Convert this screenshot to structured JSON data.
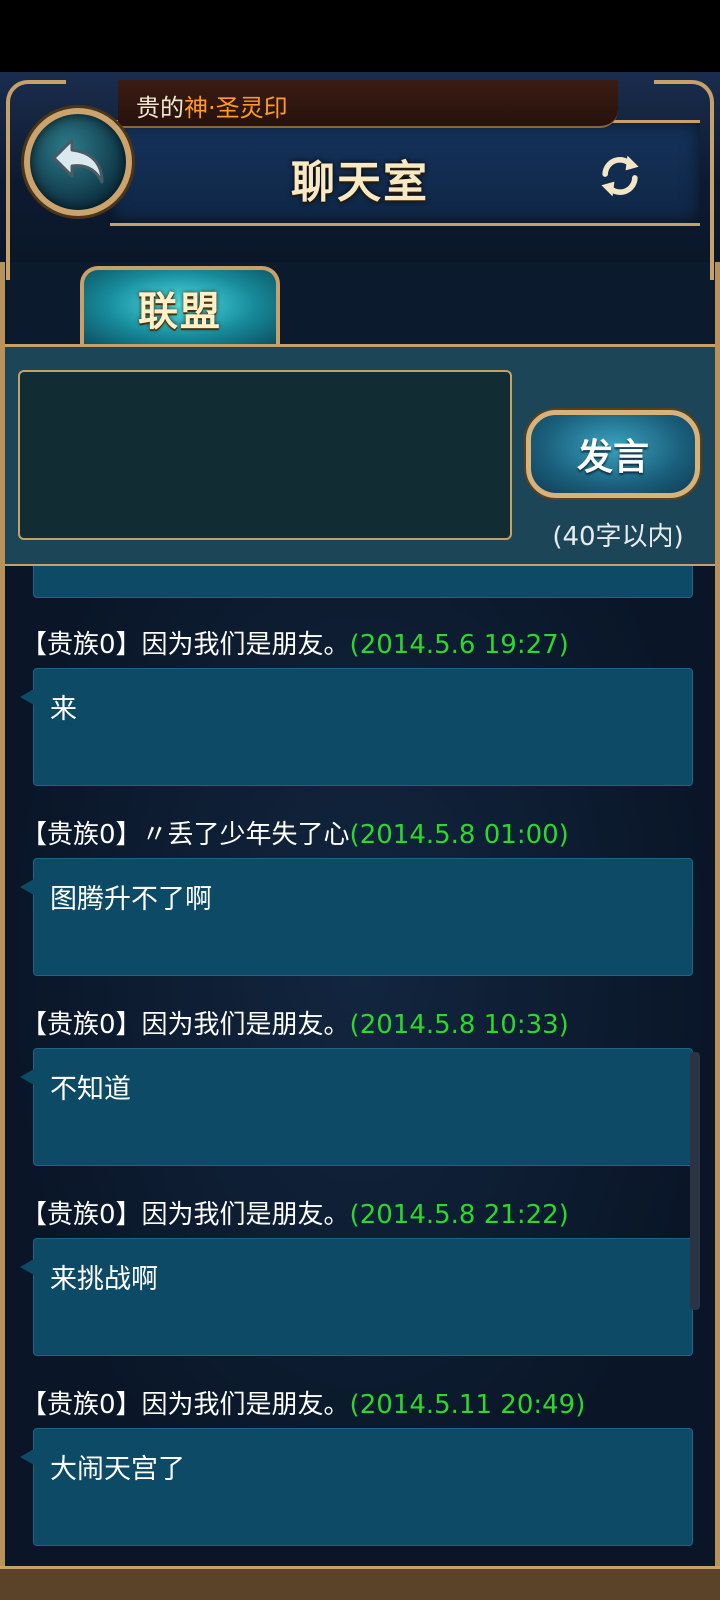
{
  "header": {
    "banner_prefix": "贵的",
    "banner_highlight": "神·圣灵印",
    "title": "聊天室",
    "back_icon": "back-arrow-icon",
    "refresh_icon": "refresh-icon"
  },
  "tabs": [
    {
      "label": "联盟",
      "selected": true
    }
  ],
  "compose": {
    "input_value": "",
    "send_label": "发言",
    "char_limit": "(40字以内)"
  },
  "messages": [
    {
      "sender": "【贵族0】因为我们是朋友。",
      "time": "(2014.5.6 19:27)",
      "text": "来"
    },
    {
      "sender": "【贵族0】〃丢了少年失了心",
      "time": "(2014.5.8 01:00)",
      "text": "图腾升不了啊"
    },
    {
      "sender": "【贵族0】因为我们是朋友。",
      "time": "(2014.5.8 10:33)",
      "text": "不知道"
    },
    {
      "sender": "【贵族0】因为我们是朋友。",
      "time": "(2014.5.8 21:22)",
      "text": "来挑战啊"
    },
    {
      "sender": "【贵族0】因为我们是朋友。",
      "time": "(2014.5.11 20:49)",
      "text": "大闹天宫了"
    }
  ],
  "colors": {
    "timestamp": "#2bd82b",
    "banner_highlight": "#ff9a2a",
    "bubble": "#0d4a66"
  }
}
